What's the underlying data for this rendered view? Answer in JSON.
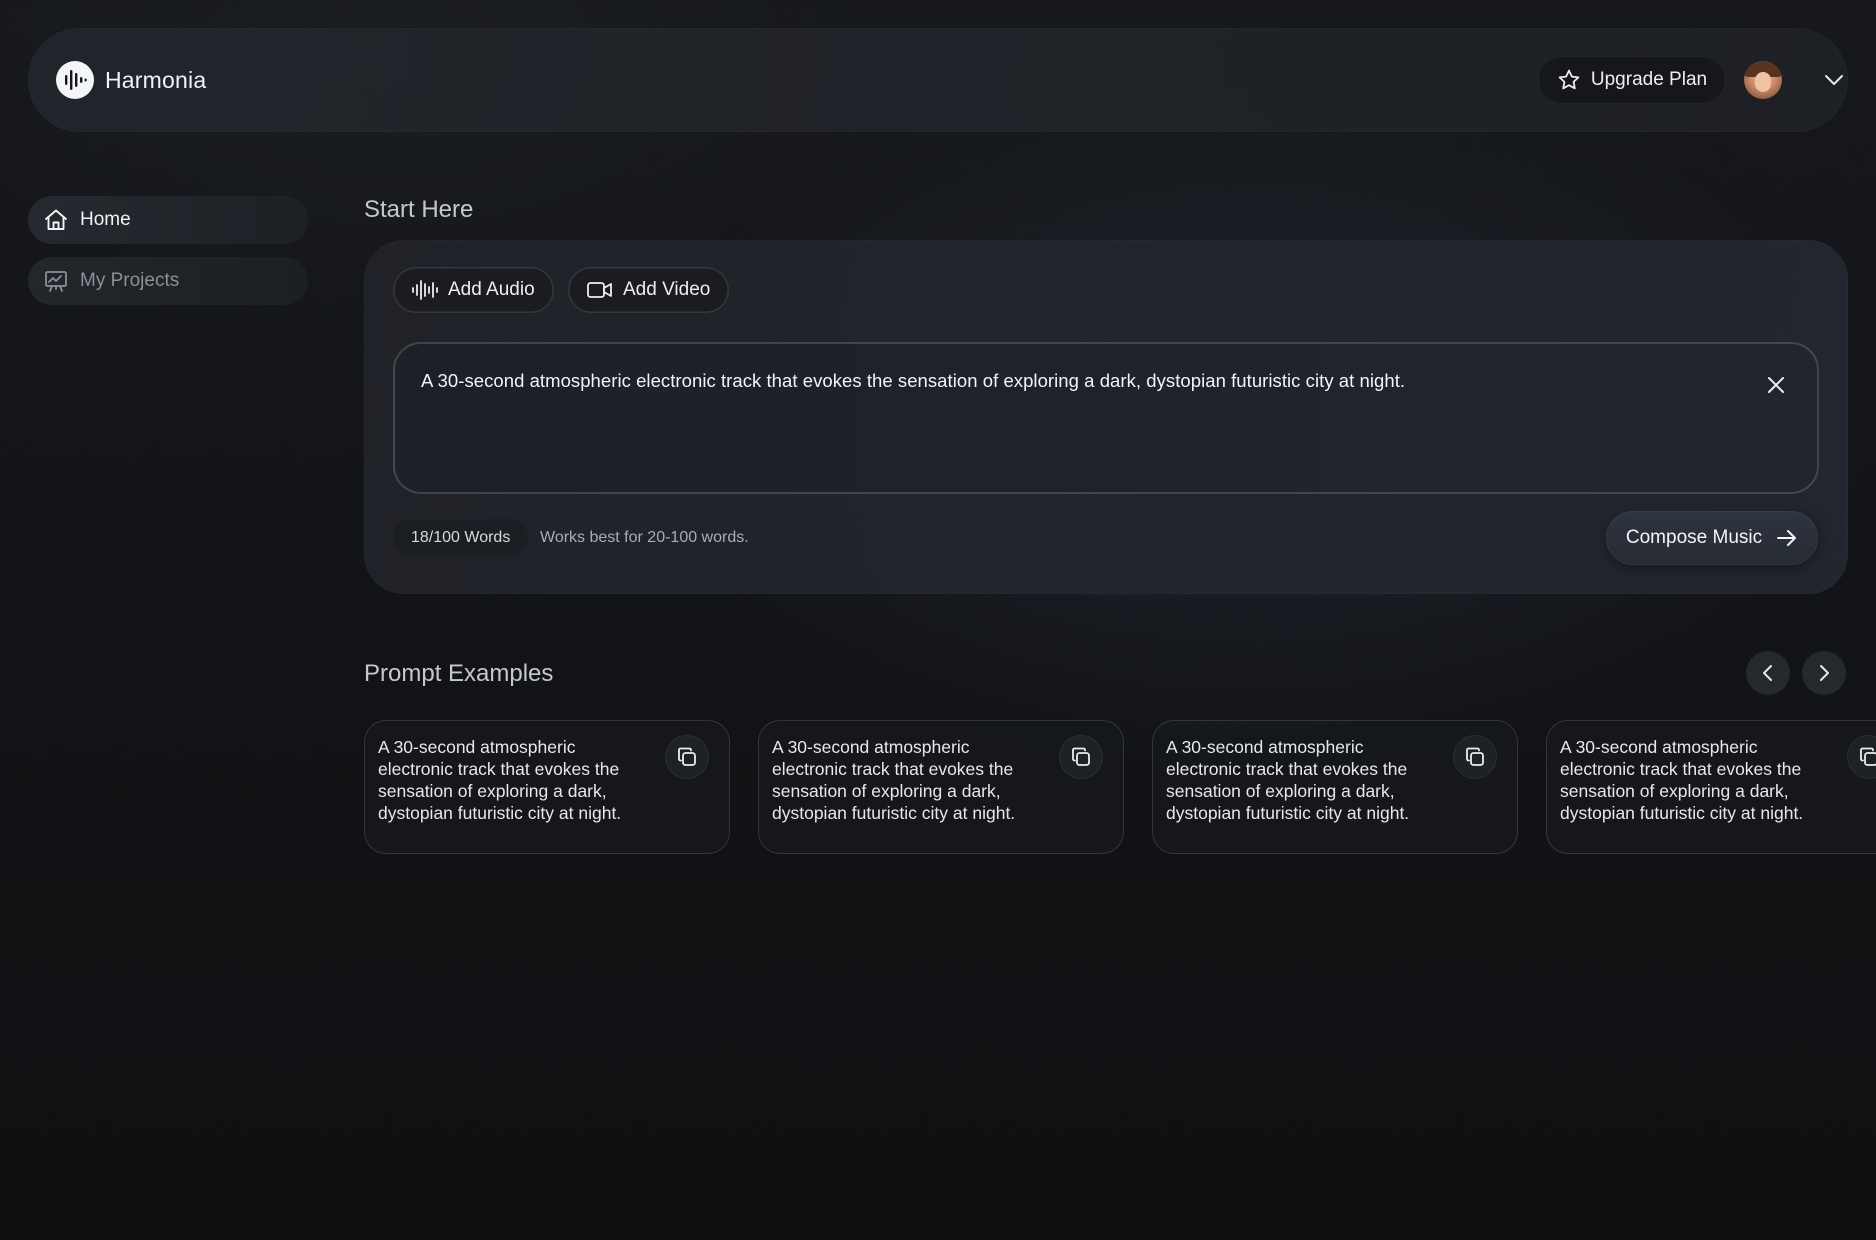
{
  "app": {
    "name": "Harmonia"
  },
  "header": {
    "upgrade_label": "Upgrade Plan",
    "upgrade_icon": "star-icon",
    "account_icon": "chevron-down-icon"
  },
  "sidebar": {
    "items": [
      {
        "label": "Home",
        "icon": "home-icon",
        "active": true
      },
      {
        "label": "My Projects",
        "icon": "projects-chart-icon",
        "active": false
      }
    ]
  },
  "start": {
    "title": "Start Here",
    "add_audio_label": "Add Audio",
    "add_video_label": "Add Video",
    "prompt_value": "A 30-second atmospheric electronic track that evokes the sensation of exploring a dark, dystopian futuristic city at night.",
    "word_count": "18/100 Words",
    "hint": "Works best for 20-100 words.",
    "compose_label": "Compose Music"
  },
  "examples": {
    "title": "Prompt Examples",
    "items": [
      {
        "text": "A 30-second atmospheric electronic track that evokes the sensation of exploring a dark, dystopian futuristic city at night."
      },
      {
        "text": "A 30-second atmospheric electronic track that evokes the sensation of exploring a dark, dystopian futuristic city at night."
      },
      {
        "text": "A 30-second atmospheric electronic track that evokes the sensation of exploring a dark, dystopian futuristic city at night."
      },
      {
        "text": "A 30-second atmospheric electronic track that evokes the sensation of exploring a dark, dystopian futuristic city at night."
      }
    ]
  },
  "colors": {
    "background": "#121316",
    "panel": "#22262d",
    "text_primary": "#f3f4f6",
    "text_muted": "#8b9097"
  }
}
